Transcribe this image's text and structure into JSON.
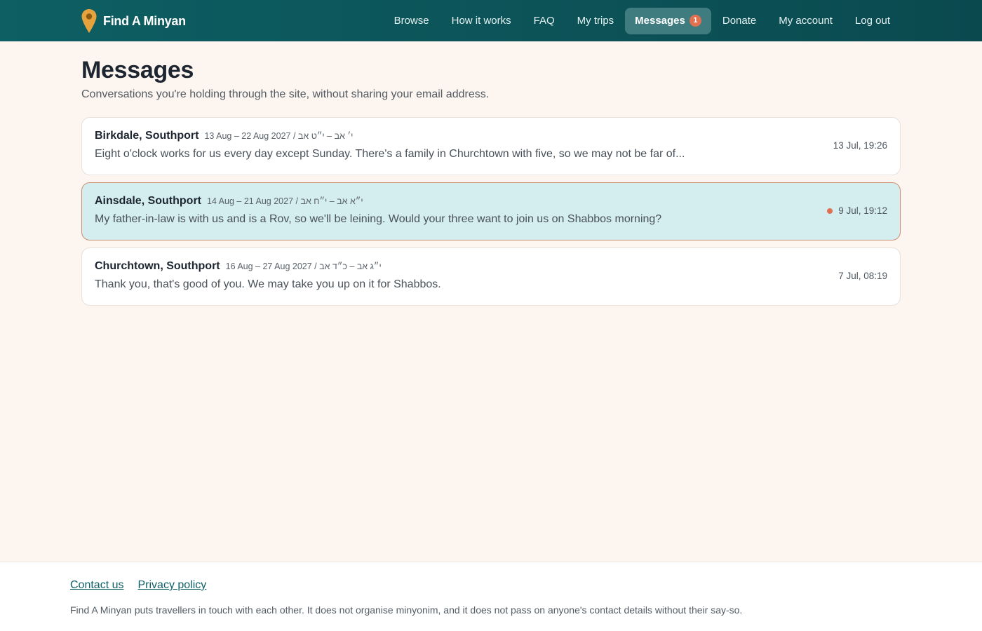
{
  "header": {
    "brand": "Find A Minyan",
    "brand_icon": "map-pin-icon",
    "colors": {
      "bar": "#0c5459",
      "active": "#3e7c7f",
      "badge": "#e0704f",
      "pin": "#e6a23c"
    },
    "nav": [
      {
        "label": "Browse"
      },
      {
        "label": "How it works"
      },
      {
        "label": "FAQ"
      },
      {
        "label": "My trips"
      },
      {
        "label": "Messages",
        "badge": "1",
        "active": true
      },
      {
        "label": "Donate"
      },
      {
        "label": "My account"
      },
      {
        "label": "Log out"
      }
    ]
  },
  "page": {
    "title": "Messages",
    "subtitle": "Conversations you're holding through the site, without sharing your email address."
  },
  "threads": [
    {
      "place": "Birkdale, Southport",
      "dates": "13 Aug – 22 Aug 2027 / י׳ אב – י״ט אב",
      "preview": "Eight o'clock works for us every day except Sunday. There's a family in Churchtown with five, so we may not be far of...",
      "time": "13 Jul, 19:26",
      "unread": false
    },
    {
      "place": "Ainsdale, Southport",
      "dates": "14 Aug – 21 Aug 2027 / י״א אב – י״ח אב",
      "preview": "My father-in-law is with us and is a Rov, so we'll be leining. Would your three want to join us on Shabbos morning?",
      "time": "9 Jul, 19:12",
      "unread": true
    },
    {
      "place": "Churchtown, Southport",
      "dates": "16 Aug – 27 Aug 2027 / י״ג אב – כ״ד אב",
      "preview": "Thank you, that's good of you. We may take you up on it for Shabbos.",
      "time": "7 Jul, 08:19",
      "unread": false
    }
  ],
  "footer": {
    "links": [
      {
        "label": "Contact us"
      },
      {
        "label": "Privacy policy"
      }
    ],
    "note": "Find A Minyan puts travellers in touch with each other. It does not organise minyonim, and it does not pass on anyone's contact details without their say-so."
  }
}
